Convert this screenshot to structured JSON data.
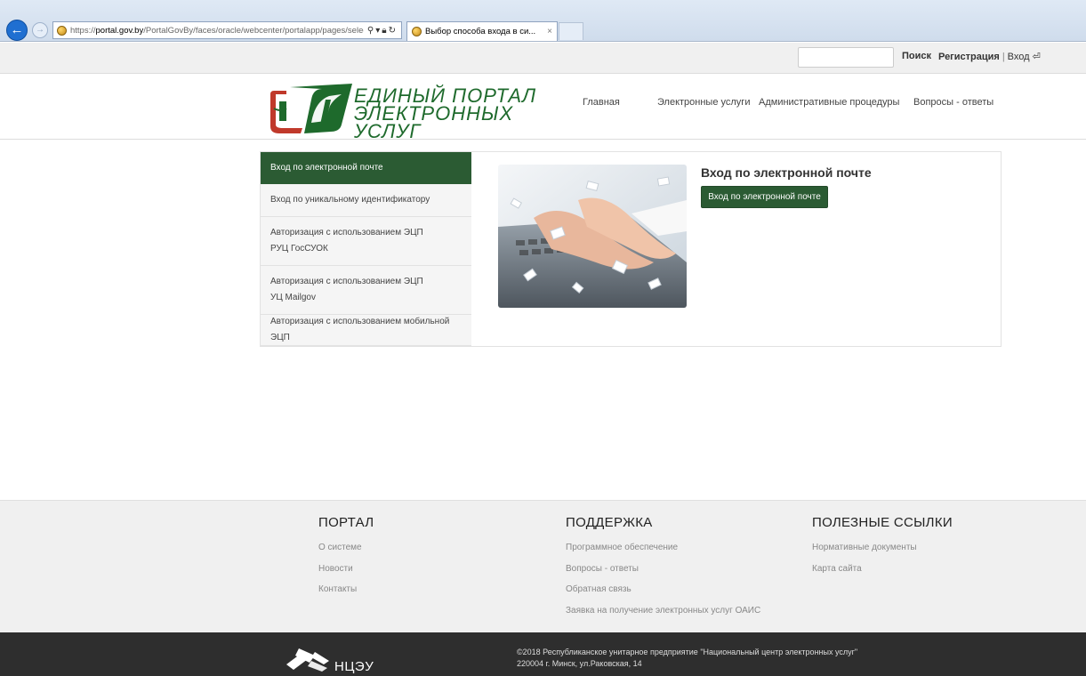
{
  "browser": {
    "url_domain": "portal.gov.by",
    "url_prefix": "https://",
    "url_rest": "/PortalGovBy/faces/oracle/webcenter/portalapp/pages/selectAu",
    "tab_title": "Выбор способа входа в си...",
    "tab_close": "×"
  },
  "topbar": {
    "search_label": "Поиск",
    "register_label": "Регистрация",
    "separator": "|",
    "login_label": "Вход",
    "login_icon": "⏎"
  },
  "header": {
    "logo_line1": "ЕДИНЫЙ ПОРТАЛ",
    "logo_line2": "ЭЛЕКТРОННЫХ УСЛУГ",
    "nav": [
      {
        "label": "Главная"
      },
      {
        "label": "Электронные услуги"
      },
      {
        "label": "Административные процедуры"
      },
      {
        "label": "Вопросы - ответы"
      }
    ]
  },
  "menu": {
    "items": [
      {
        "line1": "Вход по электронной почте",
        "line2": ""
      },
      {
        "line1": "Вход по уникальному идентификатору",
        "line2": ""
      },
      {
        "line1": "Авторизация с использованием ЭЦП",
        "line2": "РУЦ ГосСУОК"
      },
      {
        "line1": "Авторизация с использованием ЭЦП",
        "line2": "УЦ Mailgov"
      },
      {
        "line1": "Авторизация с использованием мобильной ЭЦП",
        "line2": ""
      }
    ]
  },
  "panel": {
    "title": "Вход по электронной почте",
    "button_label": "Вход по электронной почте"
  },
  "footer": {
    "columns": [
      {
        "title": "ПОРТАЛ",
        "links": [
          "О системе",
          "Новости",
          "Контакты"
        ]
      },
      {
        "title": "ПОДДЕРЖКА",
        "links": [
          "Программное обеспечение",
          "Вопросы - ответы",
          "Обратная связь",
          "Заявка на получение электронных услуг ОАИС"
        ]
      },
      {
        "title": "ПОЛЕЗНЫЕ ССЫЛКИ",
        "links": [
          "Нормативные документы",
          "Карта сайта"
        ]
      }
    ]
  },
  "bottom": {
    "org_short": "НЦЭУ",
    "copyright": "©2018 Республиканское унитарное предприятие \"Национальный центр электронных услуг\"",
    "address": "220004 г. Минск, ул.Раковская, 14"
  },
  "colors": {
    "brand_green": "#2b5b33",
    "logo_green": "#1e6a2c",
    "footer_dark": "#2e2e2e"
  }
}
